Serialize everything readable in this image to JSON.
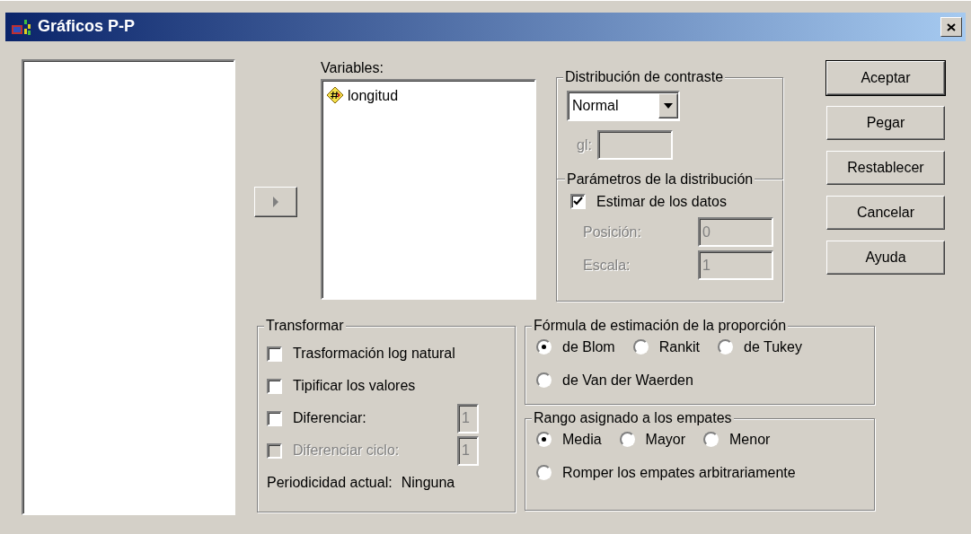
{
  "window": {
    "title": "Gráficos P-P"
  },
  "variables": {
    "label": "Variables:",
    "items": [
      {
        "name": "longitud"
      }
    ]
  },
  "test_distribution": {
    "title": "Distribución de contraste",
    "dropdown": {
      "value": "Normal"
    },
    "df": {
      "label": "gl:",
      "disabled": true
    }
  },
  "parameters": {
    "title": "Parámetros de la distribución",
    "estimate": {
      "label": "Estimar de los datos",
      "checked": true
    },
    "fields": [
      {
        "label": "Posición:",
        "value": "0",
        "disabled": true
      },
      {
        "label": "Escala:",
        "value": "1",
        "disabled": true
      }
    ]
  },
  "buttons": [
    {
      "label": "Aceptar",
      "default": true
    },
    {
      "label": "Pegar",
      "default": false
    },
    {
      "label": "Restablecer",
      "default": false
    },
    {
      "label": "Cancelar",
      "default": false
    },
    {
      "label": "Ayuda",
      "default": false
    }
  ],
  "transform": {
    "title": "Transformar",
    "options": [
      {
        "label": "Trasformación log natural",
        "checked": false,
        "disabled": false
      },
      {
        "label": "Tipificar los valores",
        "checked": false,
        "disabled": false
      },
      {
        "label": "Diferenciar:",
        "checked": false,
        "disabled": false,
        "field": {
          "value": "1",
          "disabled": true
        }
      },
      {
        "label": "Diferenciar ciclo:",
        "checked": false,
        "disabled": true,
        "field": {
          "value": "1",
          "disabled": true
        }
      }
    ],
    "periodicity": {
      "label": "Periodicidad actual:",
      "value": "Ninguna"
    }
  },
  "proportion": {
    "title": "Fórmula de estimación de la proporción",
    "rows": [
      {
        "options": [
          {
            "label": "de Blom",
            "selected": true
          },
          {
            "label": "Rankit",
            "selected": false
          },
          {
            "label": "de Tukey",
            "selected": false
          }
        ]
      },
      {
        "options": [
          {
            "label": "de Van der Waerden",
            "selected": false
          }
        ]
      }
    ]
  },
  "ties": {
    "title": "Rango asignado a los empates",
    "rows": [
      {
        "options": [
          {
            "label": "Media",
            "selected": true
          },
          {
            "label": "Mayor",
            "selected": false
          },
          {
            "label": "Menor",
            "selected": false
          }
        ]
      },
      {
        "options": [
          {
            "label": "Romper los empates arbitrariamente",
            "selected": false
          }
        ]
      }
    ]
  }
}
